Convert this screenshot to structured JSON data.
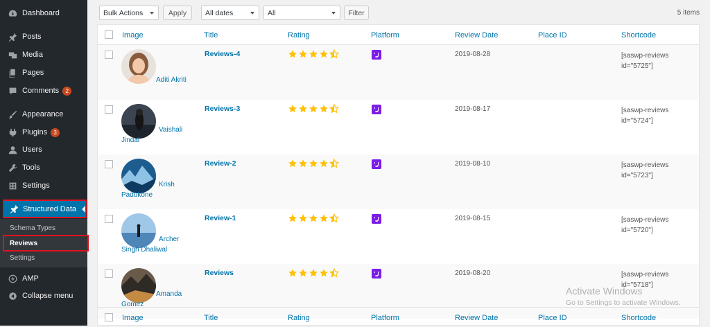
{
  "sidebar": {
    "items": [
      {
        "label": "Dashboard",
        "icon": "dashboard-icon"
      },
      {
        "label": "Posts",
        "icon": "pin-icon"
      },
      {
        "label": "Media",
        "icon": "media-icon"
      },
      {
        "label": "Pages",
        "icon": "pages-icon"
      },
      {
        "label": "Comments",
        "icon": "comment-icon",
        "badge": "2"
      },
      {
        "label": "Appearance",
        "icon": "brush-icon"
      },
      {
        "label": "Plugins",
        "icon": "plugin-icon",
        "badge": "3"
      },
      {
        "label": "Users",
        "icon": "user-icon"
      },
      {
        "label": "Tools",
        "icon": "wrench-icon"
      },
      {
        "label": "Settings",
        "icon": "settings-icon"
      }
    ],
    "active": {
      "label": "Structured Data",
      "icon": "pin-icon"
    },
    "submenu": [
      "Schema Types",
      "Reviews",
      "Settings"
    ],
    "amp": "AMP",
    "collapse": "Collapse menu"
  },
  "toolbar": {
    "bulk_actions": "Bulk Actions",
    "apply": "Apply",
    "dates": "All dates",
    "all": "All",
    "filter": "Filter",
    "count": "5 items"
  },
  "columns": [
    "Image",
    "Title",
    "Rating",
    "Platform",
    "Review Date",
    "Place ID",
    "Shortcode"
  ],
  "rows": [
    {
      "name": "Aditi Akriti",
      "title": "Reviews-4",
      "rating": 4.5,
      "date": "2019-08-28",
      "shortcode_1": "[saswp-reviews",
      "shortcode_2": "id=\"5725\"]"
    },
    {
      "name": "Vaishali Jindal",
      "name_1": "Vaishali",
      "name_2": "Jindal",
      "title": "Reviews-3",
      "rating": 4.5,
      "date": "2019-08-17",
      "shortcode_1": "[saswp-reviews",
      "shortcode_2": "id=\"5724\"]"
    },
    {
      "name": "Krish Padukone",
      "name_1": "Krish",
      "name_2": "Padukone",
      "title": "Review-2",
      "rating": 4.5,
      "date": "2019-08-10",
      "shortcode_1": "[saswp-reviews",
      "shortcode_2": "id=\"5723\"]"
    },
    {
      "name": "Archer Singh Dhaliwal",
      "name_1": "Archer",
      "name_2": "Singh Dhaliwal",
      "title": "Review-1",
      "rating": 4.5,
      "date": "2019-08-15",
      "shortcode_1": "[saswp-reviews",
      "shortcode_2": "id=\"5720\"]"
    },
    {
      "name": "Amanda Gomez",
      "name_1": "Amanda",
      "name_2": "Gomez",
      "title": "Reviews",
      "rating": 4.5,
      "date": "2019-08-20",
      "shortcode_1": "[saswp-reviews",
      "shortcode_2": "id=\"5718\"]"
    }
  ],
  "watermark": {
    "line1": "Activate Windows",
    "line2": "Go to Settings to activate Windows."
  },
  "colors": {
    "sidebar_bg": "#23282d",
    "accent": "#0073aa",
    "star": "#ffc107",
    "platform": "#7b1ee6",
    "badge": "#ca4a1f",
    "highlight_border": "#e0121e"
  }
}
